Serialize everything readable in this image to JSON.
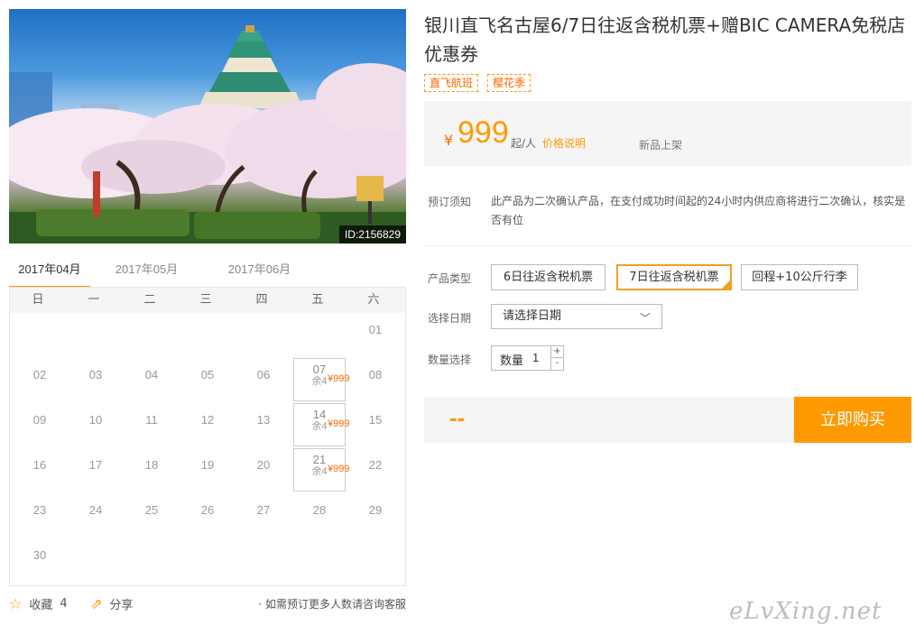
{
  "product": {
    "image_id": "ID:2156829",
    "title": "银川直飞名古屋6/7日往返含税机票+赠BIC CAMERA免税店优惠券",
    "tags": [
      "直飞航班",
      "樱花季"
    ],
    "currency": "¥",
    "price": "999",
    "price_unit": "起/人",
    "price_note": "价格说明",
    "new_badge": "新品上架"
  },
  "notice": {
    "label": "预订须知",
    "text": "此产品为二次确认产品，在支付成功时间起的24小时内供应商将进行二次确认，核实是否有位"
  },
  "options": {
    "type_label": "产品类型",
    "types": [
      "6日往返含税机票",
      "7日往返含税机票",
      "回程+10公斤行李"
    ],
    "selected_type": "7日往返含税机票",
    "date_label": "选择日期",
    "date_placeholder": "请选择日期",
    "qty_label": "数量选择",
    "qty_inner_label": "数量",
    "qty_value": "1",
    "qty_plus": "+",
    "qty_minus": "-"
  },
  "buy": {
    "total": "--",
    "button": "立即购买"
  },
  "calendar": {
    "months": [
      "2017年04月",
      "2017年05月",
      "2017年06月"
    ],
    "active_month": "2017年04月",
    "weekdays": [
      "日",
      "一",
      "二",
      "三",
      "四",
      "五",
      "六"
    ],
    "first_weekday": 6,
    "days_in_month": 30,
    "available": {
      "07": {
        "price": "¥999",
        "stock": "余4"
      },
      "14": {
        "price": "¥999",
        "stock": "余4"
      },
      "21": {
        "price": "¥999",
        "stock": "余4"
      }
    }
  },
  "footer": {
    "favorite_label": "收藏",
    "favorite_count": "4",
    "share_label": "分享",
    "consult_text": "· 如需预订更多人数请咨询客服"
  },
  "watermark": "eLvXing.net",
  "colors": {
    "accent": "#ff9900",
    "price": "#ff6600"
  }
}
